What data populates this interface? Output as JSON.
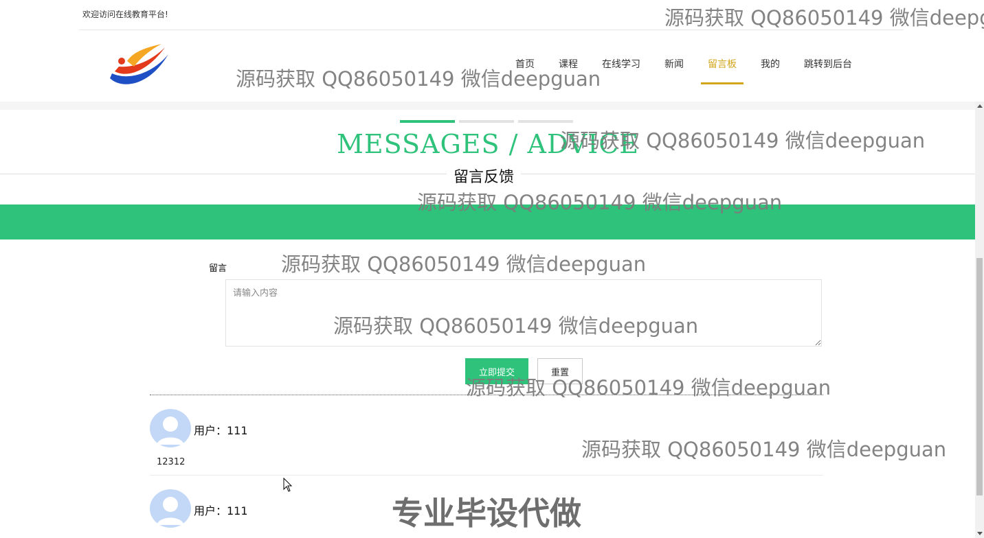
{
  "topbar": {
    "welcome": "欢迎访问在线教育平台!"
  },
  "nav": {
    "items": [
      {
        "label": "首页"
      },
      {
        "label": "课程"
      },
      {
        "label": "在线学习"
      },
      {
        "label": "新闻"
      },
      {
        "label": "留言板",
        "active": true
      },
      {
        "label": "我的"
      },
      {
        "label": "跳转到后台"
      }
    ]
  },
  "section": {
    "title_en": "MESSAGES / ADVICE",
    "title_cn": "留言反馈"
  },
  "form": {
    "label": "留言",
    "placeholder": "请输入内容",
    "submit_label": "立即提交",
    "reset_label": "重置"
  },
  "comments": [
    {
      "user": "用户：111",
      "content": "12312"
    },
    {
      "user": "用户：111",
      "content": ""
    }
  ],
  "watermark": {
    "text": "源码获取 QQ86050149 微信deepguan",
    "text_cut": "源码获取 QQ86050149 微信deepg",
    "bold": "专业毕设代做"
  },
  "colors": {
    "accent": "#2ec27b",
    "nav_active": "#d2a51a"
  }
}
